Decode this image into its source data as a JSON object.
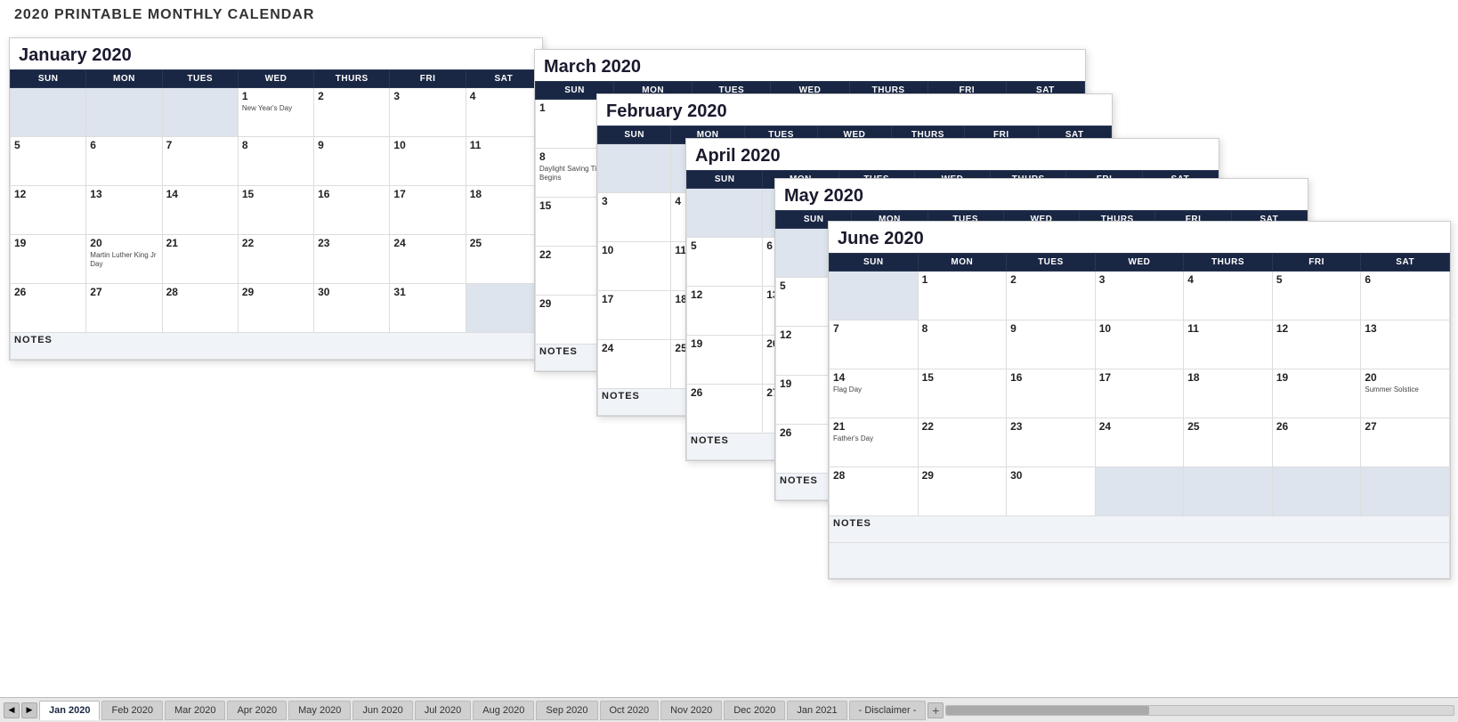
{
  "page": {
    "title": "2020 PRINTABLE MONTHLY CALENDAR"
  },
  "tabs": [
    {
      "label": "Jan 2020",
      "active": true
    },
    {
      "label": "Feb 2020",
      "active": false
    },
    {
      "label": "Mar 2020",
      "active": false
    },
    {
      "label": "Apr 2020",
      "active": false
    },
    {
      "label": "May 2020",
      "active": false
    },
    {
      "label": "Jun 2020",
      "active": false
    },
    {
      "label": "Jul 2020",
      "active": false
    },
    {
      "label": "Aug 2020",
      "active": false
    },
    {
      "label": "Sep 2020",
      "active": false
    },
    {
      "label": "Oct 2020",
      "active": false
    },
    {
      "label": "Nov 2020",
      "active": false
    },
    {
      "label": "Dec 2020",
      "active": false
    },
    {
      "label": "Jan 2021",
      "active": false
    },
    {
      "label": "- Disclaimer -",
      "active": false
    }
  ],
  "january": {
    "title": "January 2020",
    "days_header": [
      "SUN",
      "MON",
      "TUES",
      "WED",
      "THURS",
      "FRI",
      "SAT"
    ]
  },
  "march": {
    "title": "March 2020",
    "days_header": [
      "SUN",
      "MON",
      "TUES",
      "WED",
      "THURS",
      "FRI",
      "SAT"
    ]
  },
  "february": {
    "title": "February 2020",
    "days_header": [
      "SUN",
      "MON",
      "TUES",
      "WED",
      "THURS",
      "FRI",
      "SAT"
    ]
  },
  "april": {
    "title": "April 2020",
    "days_header": [
      "SUN",
      "MON",
      "TUES",
      "WED",
      "THURS",
      "FRI",
      "SAT"
    ]
  },
  "may": {
    "title": "May 2020",
    "days_header": [
      "SUN",
      "MON",
      "TUES",
      "WED",
      "THURS",
      "FRI",
      "SAT"
    ]
  },
  "june": {
    "title": "June 2020",
    "days_header": [
      "SUN",
      "MON",
      "TUES",
      "WED",
      "THURS",
      "FRI",
      "SAT"
    ]
  }
}
